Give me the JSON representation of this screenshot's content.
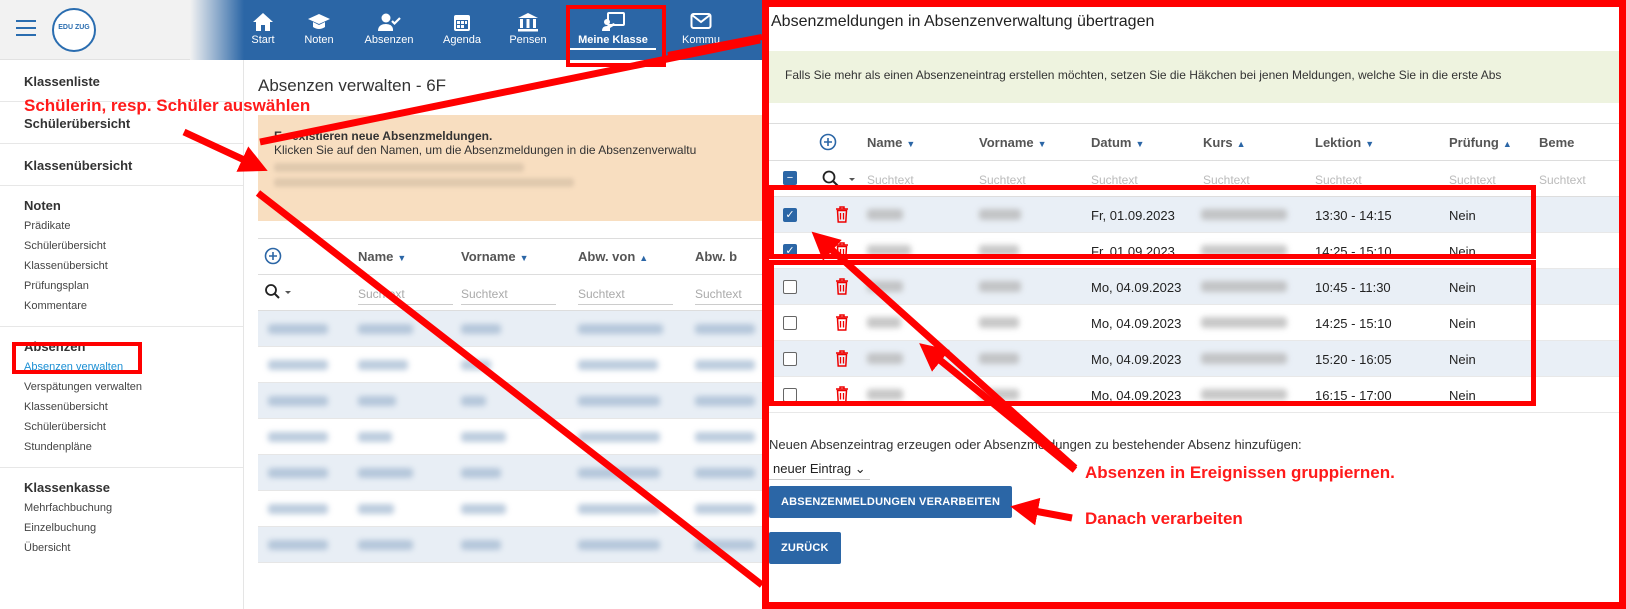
{
  "sidebar": {
    "logo_text": "EDU ZUG",
    "sections": [
      {
        "title": "Klassenliste",
        "items": []
      },
      {
        "title": "Schülerübersicht",
        "items": []
      },
      {
        "title": "Klassenübersicht",
        "items": []
      },
      {
        "title": "Noten",
        "items": [
          "Prädikate",
          "Schülerübersicht",
          "Klassenübersicht",
          "Prüfungsplan",
          "Kommentare"
        ]
      },
      {
        "title": "Absenzen",
        "items": [
          "Absenzen verwalten",
          "Verspätungen verwalten",
          "Klassenübersicht",
          "Schülerübersicht",
          "Stundenpläne"
        ]
      },
      {
        "title": "Klassenkasse",
        "items": [
          "Mehrfachbuchung",
          "Einzelbuchung",
          "Übersicht"
        ]
      }
    ]
  },
  "topnav": {
    "items": [
      "Start",
      "Noten",
      "Absenzen",
      "Agenda",
      "Pensen",
      "Meine Klasse",
      "Kommu"
    ],
    "active": "Meine Klasse"
  },
  "main": {
    "title": "Absenzen verwalten - 6F",
    "notice_title": "Es existieren neue Absenzmeldungen.",
    "notice_text": "Klicken Sie auf den Namen, um die Absenzmeldungen in die Absenzenverwaltu",
    "columns": [
      "Name",
      "Vorname",
      "Abw. von",
      "Abw. b"
    ],
    "search_placeholder": "Suchtext"
  },
  "dialog": {
    "title": "Absenzmeldungen in Absenzenverwaltung übertragen",
    "info": "Falls Sie mehr als einen Absenzeneintrag erstellen möchten, setzen Sie die Häkchen bei jenen Meldungen, welche Sie in die erste Abs",
    "columns": [
      "Name",
      "Vorname",
      "Datum",
      "Kurs",
      "Lektion",
      "Prüfung",
      "Beme"
    ],
    "search_placeholder": "Suchtext",
    "rows": [
      {
        "checked": true,
        "datum": "Fr, 01.09.2023",
        "lektion": "13:30 - 14:15",
        "pruefung": "Nein"
      },
      {
        "checked": true,
        "datum": "Fr, 01.09.2023",
        "lektion": "14:25 - 15:10",
        "pruefung": "Nein"
      },
      {
        "checked": false,
        "datum": "Mo, 04.09.2023",
        "lektion": "10:45 - 11:30",
        "pruefung": "Nein"
      },
      {
        "checked": false,
        "datum": "Mo, 04.09.2023",
        "lektion": "14:25 - 15:10",
        "pruefung": "Nein"
      },
      {
        "checked": false,
        "datum": "Mo, 04.09.2023",
        "lektion": "15:20 - 16:05",
        "pruefung": "Nein"
      },
      {
        "checked": false,
        "datum": "Mo, 04.09.2023",
        "lektion": "16:15 - 17:00",
        "pruefung": "Nein"
      }
    ],
    "entry_text": "Neuen Absenzeintrag erzeugen oder Absenzmeldungen zu bestehender Absenz hinzufügen:",
    "select_value": "neuer Eintrag",
    "process_button": "ABSENZENMELDUNGEN VERARBEITEN",
    "back_button": "ZURÜCK"
  },
  "annotations": {
    "select_student": "Schülerin, resp. Schüler auswählen",
    "group": "Absenzen in Ereignissen gruppiernen.",
    "process": "Danach verarbeiten"
  },
  "colors": {
    "nav": "#2b66a6",
    "annotation": "#ff0000",
    "notice": "#f8dec0",
    "info": "#eef3df"
  }
}
